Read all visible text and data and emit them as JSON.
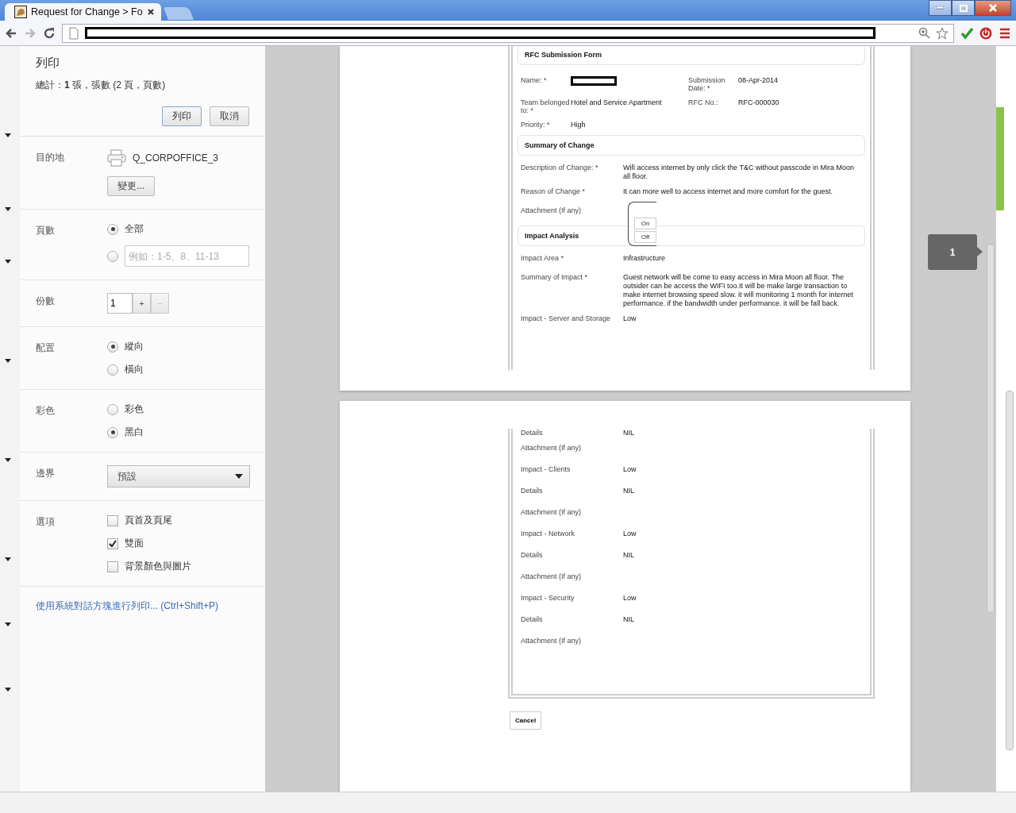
{
  "browser": {
    "tab_title": "Request for Change > Fo"
  },
  "print_dialog": {
    "title": "列印",
    "summary": "總計：**1** 張，張數 (2 頁，頁數)",
    "print_button": "列印",
    "cancel_button": "取消",
    "sections": [
      {
        "kind": "destination",
        "label": "目的地",
        "printer": "Q_CORPOFFICE_3",
        "change_button": "變更..."
      },
      {
        "kind": "radio",
        "label": "頁數",
        "options": [
          {
            "label": "全部",
            "selected": true
          },
          {
            "placeholder": "例如：1-5、8、11-13",
            "selected": false
          }
        ]
      },
      {
        "kind": "copies",
        "label": "份數",
        "value": "1",
        "plus": "+",
        "minus": "−"
      },
      {
        "kind": "radio",
        "label": "配置",
        "options": [
          {
            "label": "縱向",
            "selected": true
          },
          {
            "label": "橫向",
            "selected": false
          }
        ]
      },
      {
        "kind": "radio",
        "label": "彩色",
        "options": [
          {
            "label": "彩色",
            "selected": false
          },
          {
            "label": "黑白",
            "selected": true
          }
        ]
      },
      {
        "kind": "select",
        "label": "邊界",
        "value": "預設"
      },
      {
        "kind": "checkbox",
        "label": "選項",
        "options": [
          {
            "label": "頁首及頁尾",
            "checked": false
          },
          {
            "label": "雙面",
            "checked": true
          },
          {
            "label": "背景顏色與圖片",
            "checked": false
          }
        ]
      }
    ],
    "system_dialog_link": "使用系統對話方塊進行列印... (Ctrl+Shift+P)"
  },
  "preview": {
    "page_badge": "1",
    "cancel_button": "Cancel",
    "pages": [
      {
        "blocks": [
          {
            "kind": "heading",
            "text": "RFC Submission Form"
          },
          {
            "kind": "grid",
            "rows": [
              {
                "label": "Name: *",
                "redacted": true,
                "label2": "Submission Date: *",
                "value2": "08-Apr-2014"
              },
              {
                "label": "Team belonged to: *",
                "value": "Hotel and Service Apartment",
                "label2": "RFC No.:",
                "value2": "RFC-000030"
              },
              {
                "label": "Priority: *",
                "value": "High"
              }
            ]
          },
          {
            "kind": "heading",
            "text": "Summary of Change"
          },
          {
            "kind": "row",
            "label": "Description of Change: *",
            "value": "Wifi access internet by only click the T&C without passcode in Mira Moon all floor."
          },
          {
            "kind": "row",
            "label": "Reason of Change *",
            "value": "It can more well to access internet and more comfort for the guest."
          },
          {
            "kind": "row",
            "label": "Attachment (If any)",
            "toggle": [
              "On",
              "Off"
            ]
          },
          {
            "kind": "heading",
            "text": "Impact Analysis"
          },
          {
            "kind": "row",
            "label": "Impact Area *",
            "value": "Infrastructure"
          },
          {
            "kind": "row",
            "label": "Summary of Impact *",
            "value": "Guest network will be come to easy access in Mira Moon all floor. The outsider can be access the WIFI too.It will be make large transaction to make internet browsing speed slow. it will monitoring 1 month for internet performance. if the bandwidth under performance. it will be fall back."
          },
          {
            "kind": "row",
            "label": "Impact - Server and Storage",
            "value": "Low"
          }
        ]
      },
      {
        "blocks": [
          {
            "kind": "row",
            "label": "Details",
            "value": "NIL"
          },
          {
            "kind": "row",
            "label": "Attachment (If any)"
          },
          {
            "kind": "row",
            "label": "Impact - Clients",
            "value": "Low"
          },
          {
            "kind": "row",
            "label": "Details",
            "value": "NIL"
          },
          {
            "kind": "row",
            "label": "Attachment (If any)"
          },
          {
            "kind": "row",
            "label": "Impact - Network",
            "value": "Low"
          },
          {
            "kind": "row",
            "label": "Details",
            "value": "NIL"
          },
          {
            "kind": "row",
            "label": "Attachment (If any)"
          },
          {
            "kind": "row",
            "label": "Impact - Security",
            "value": "Low"
          },
          {
            "kind": "row",
            "label": "Details",
            "value": "NIL"
          },
          {
            "kind": "row",
            "label": "Attachment (If any)"
          }
        ]
      }
    ]
  }
}
